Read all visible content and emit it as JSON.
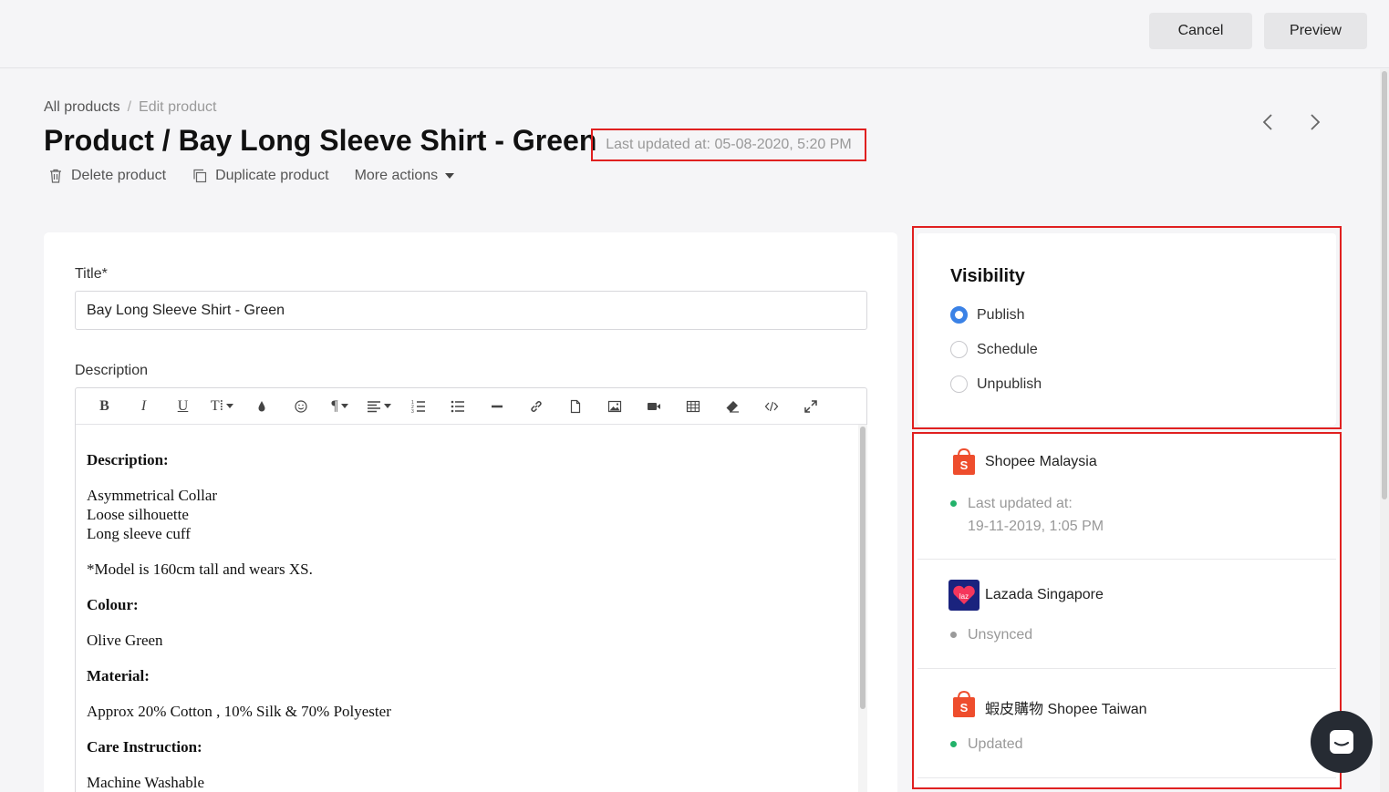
{
  "header": {
    "cancel_label": "Cancel",
    "preview_label": "Preview"
  },
  "breadcrumb": {
    "root": "All products",
    "separator": "/",
    "current": "Edit product"
  },
  "page": {
    "title": "Product / Bay Long Sleeve Shirt - Green",
    "last_updated": "Last updated at: 05-08-2020, 5:20 PM"
  },
  "actions": {
    "delete": "Delete product",
    "duplicate": "Duplicate product",
    "more": "More actions"
  },
  "form": {
    "title_label": "Title*",
    "title_value": "Bay Long Sleeve Shirt - Green",
    "description_label": "Description"
  },
  "toolbar_icons": [
    "bold-icon",
    "italic-icon",
    "underline-icon",
    "text-size-icon",
    "color-drop-icon",
    "emoji-icon",
    "paragraph-icon",
    "align-icon",
    "ordered-list-icon",
    "unordered-list-icon",
    "horizontal-rule-icon",
    "link-icon",
    "file-icon",
    "image-icon",
    "video-icon",
    "table-icon",
    "clear-format-icon",
    "code-view-icon",
    "fullscreen-icon"
  ],
  "description": {
    "heading1": "Description:",
    "line1": "Asymmetrical Collar",
    "line2": "Loose silhouette",
    "line3": "Long sleeve cuff",
    "model_note": "*Model is 160cm tall and wears XS.",
    "heading2": "Colour:",
    "colour": "Olive Green",
    "heading3": "Material:",
    "material": "Approx 20% Cotton , 10% Silk & 70% Polyester",
    "heading4": "Care Instruction:",
    "care": "Machine Washable"
  },
  "visibility": {
    "title": "Visibility",
    "options": [
      "Publish",
      "Schedule",
      "Unpublish"
    ],
    "selected": "Publish"
  },
  "channels": [
    {
      "name": "Shopee Malaysia",
      "status_line1": "Last updated at:",
      "status_line2": "19-11-2019, 1:05 PM",
      "status_color": "#22b26a"
    },
    {
      "name": "Lazada Singapore",
      "status_line1": "Unsynced",
      "status_color": "#9a9a9a"
    },
    {
      "name": "蝦皮購物 Shopee Taiwan",
      "status_line1": "Updated",
      "status_color": "#22b26a"
    }
  ],
  "colors": {
    "accent": "#3b82e6",
    "highlight_border": "#e02020",
    "shopee": "#ee4d2d",
    "lazada": "#1a237e"
  }
}
